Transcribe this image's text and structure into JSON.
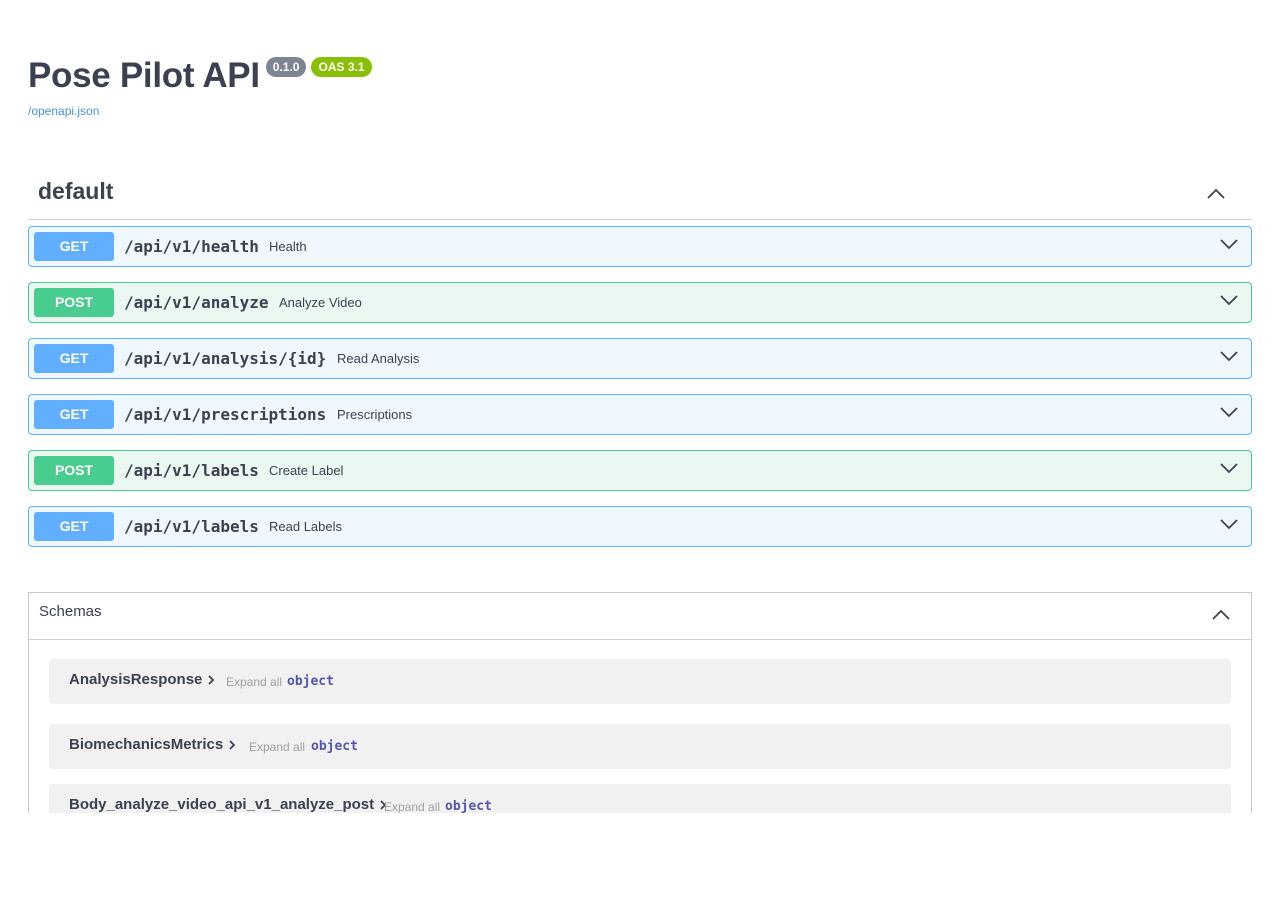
{
  "info": {
    "title": "Pose Pilot API",
    "version": "0.1.0",
    "oas_version": "OAS 3.1",
    "spec_link": "/openapi.json"
  },
  "tag": {
    "name": "default",
    "icon": "chevron-up-icon"
  },
  "operations": [
    {
      "method": "GET",
      "path": "/api/v1/health",
      "summary": "Health"
    },
    {
      "method": "POST",
      "path": "/api/v1/analyze",
      "summary": "Analyze Video"
    },
    {
      "method": "GET",
      "path": "/api/v1/analysis/{id}",
      "summary": "Read Analysis"
    },
    {
      "method": "GET",
      "path": "/api/v1/prescriptions",
      "summary": "Prescriptions"
    },
    {
      "method": "POST",
      "path": "/api/v1/labels",
      "summary": "Create Label"
    },
    {
      "method": "GET",
      "path": "/api/v1/labels",
      "summary": "Read Labels"
    }
  ],
  "schemas": {
    "title": "Schemas",
    "models": [
      {
        "name": "AnalysisResponse",
        "expand_label": "Expand all",
        "type": "object"
      },
      {
        "name": "BiomechanicsMetrics",
        "expand_label": "Expand all",
        "type": "object"
      },
      {
        "name": "Body_analyze_video_api_v1_analyze_post",
        "expand_label": "Expand all",
        "type": "object"
      }
    ]
  },
  "colors": {
    "get": "#61affe",
    "post": "#49cc90",
    "version_badge": "#7d8492",
    "oas_badge": "#89bf04",
    "link": "#4990e2"
  }
}
